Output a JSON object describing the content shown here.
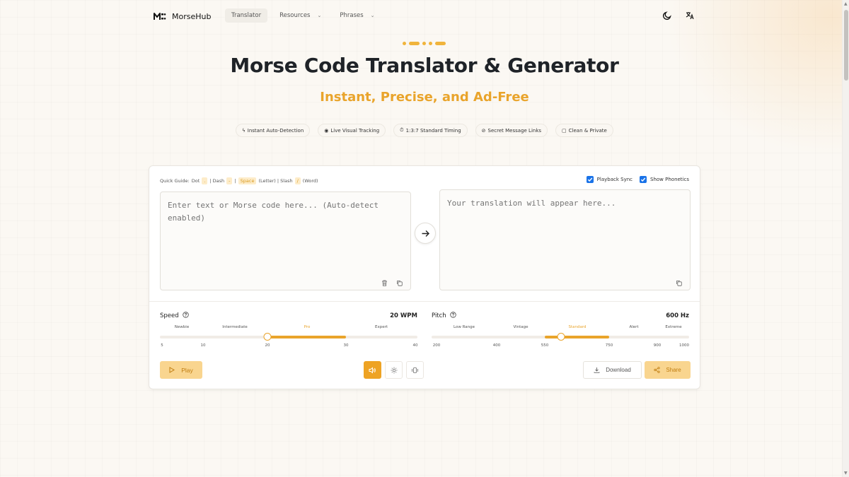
{
  "nav": {
    "brand": "MorseHub",
    "items": [
      {
        "label": "Translator",
        "active": true,
        "dropdown": false
      },
      {
        "label": "Resources",
        "active": false,
        "dropdown": true
      },
      {
        "label": "Phrases",
        "active": false,
        "dropdown": true
      }
    ],
    "icons": [
      "moon-icon",
      "language-icon"
    ]
  },
  "hero": {
    "title": "Morse Code Translator & Generator",
    "subtitle": "Instant, Precise, and Ad-Free",
    "features": [
      {
        "icon": "lightning-icon",
        "label": "Instant Auto-Detection"
      },
      {
        "icon": "eye-icon",
        "label": "Live Visual Tracking"
      },
      {
        "icon": "timer-icon",
        "label": "1:3:7 Standard Timing"
      },
      {
        "icon": "link-icon",
        "label": "Secret Message Links"
      },
      {
        "icon": "shield-icon",
        "label": "Clean & Private"
      }
    ]
  },
  "guide": {
    "prefix": "Quick Guide:",
    "dot_label": "Dot",
    "dot_key": ".",
    "dash_label": "| Dash",
    "dash_key": "-",
    "sep1": "|",
    "space_key": "Space",
    "letter_label": "(Letter) | Slash",
    "slash_key": "/",
    "word_label": "(Word)"
  },
  "options": {
    "playback_sync": {
      "label": "Playback Sync",
      "checked": true
    },
    "show_phonetics": {
      "label": "Show Phonetics",
      "checked": true
    }
  },
  "input": {
    "placeholder": "Enter text or Morse code here... (Auto-detect enabled)"
  },
  "output": {
    "placeholder": "Your translation will appear here..."
  },
  "speed": {
    "label": "Speed",
    "value_text": "20 WPM",
    "value": 20,
    "min": 5,
    "max": 40,
    "levels": [
      {
        "label": "Newbie",
        "highlight": false
      },
      {
        "label": "Intermediate",
        "highlight": false
      },
      {
        "label": "Pro",
        "highlight": true
      },
      {
        "label": "Expert",
        "highlight": false
      }
    ],
    "ticks": [
      "5",
      "10",
      "20",
      "30",
      "40"
    ],
    "range_start": 20,
    "range_end": 30
  },
  "pitch": {
    "label": "Pitch",
    "value_text": "600 Hz",
    "value": 600,
    "min": 200,
    "max": 1000,
    "levels": [
      {
        "label": "Low Range",
        "highlight": false
      },
      {
        "label": "Vintage",
        "highlight": false
      },
      {
        "label": "Standard",
        "highlight": true
      },
      {
        "label": "Alert",
        "highlight": false
      },
      {
        "label": "Extreme",
        "highlight": false
      }
    ],
    "ticks": [
      "200",
      "400",
      "550",
      "750",
      "900",
      "1000"
    ],
    "range_start": 550,
    "range_end": 750
  },
  "actions": {
    "play": "Play",
    "download": "Download",
    "share": "Share",
    "modes": [
      {
        "icon": "speaker-icon",
        "active": true
      },
      {
        "icon": "light-icon",
        "active": false
      },
      {
        "icon": "vibrate-icon",
        "active": false
      }
    ]
  },
  "colors": {
    "accent": "#e9a42b",
    "checkbox": "#1a73e8",
    "background": "#fbf8f3"
  }
}
